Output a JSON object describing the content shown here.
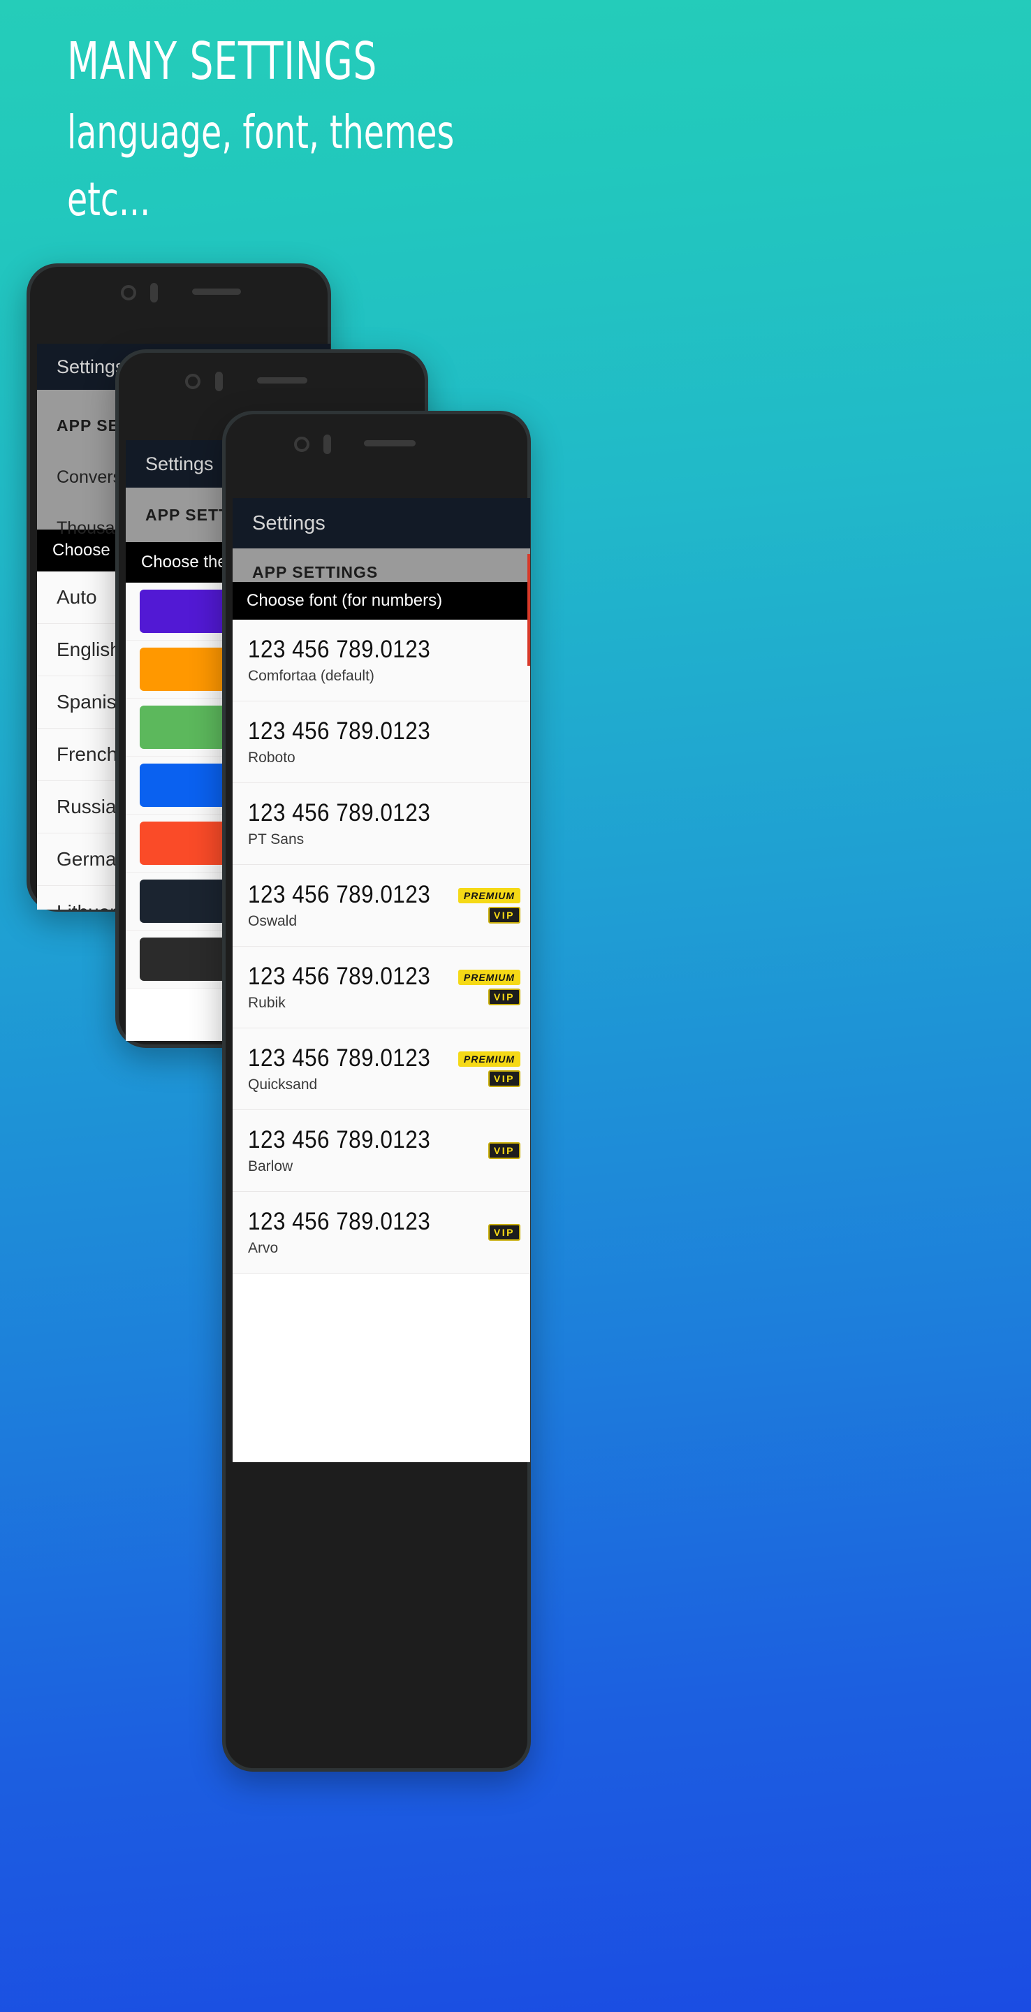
{
  "headline": {
    "line1": "MANY SETTINGS",
    "line2": "language, font, themes",
    "line3": "etc..."
  },
  "background": {
    "top_color": "#25cdb9",
    "bottom_color": "#1b4ce3"
  },
  "phone1": {
    "appbar_title": "Settings",
    "section_header": "APP SETTINGS",
    "setting_rows": [
      "Conversion",
      "Thousand s"
    ],
    "dialog": {
      "title": "Choose app lan",
      "items": [
        "Auto",
        "English",
        "Spanish",
        "French",
        "Russian",
        "German",
        "Lithuanian"
      ]
    }
  },
  "phone2": {
    "appbar_title": "Settings",
    "section_header": "APP SETTINGS",
    "dialog": {
      "title": "Choose theme",
      "swatches": [
        {
          "name": "purple",
          "color": "#5219d4"
        },
        {
          "name": "orange",
          "color": "#ff9800"
        },
        {
          "name": "green",
          "color": "#5cb85c"
        },
        {
          "name": "blue",
          "color": "#0a61f0"
        },
        {
          "name": "red",
          "color": "#fa4b28"
        },
        {
          "name": "navy",
          "color": "#1b2430"
        },
        {
          "name": "dark",
          "color": "#2b2b2b"
        }
      ]
    }
  },
  "phone3": {
    "appbar_title": "Settings",
    "section_header": "APP SETTINGS",
    "dialog": {
      "title": "Choose font (for numbers)",
      "sample": "123 456 789.0123",
      "badge_premium": "PREMIUM",
      "badge_vip": "VIP",
      "fonts": [
        {
          "name": "Comfortaa (default)",
          "premium": false,
          "vip": false
        },
        {
          "name": "Roboto",
          "premium": false,
          "vip": false
        },
        {
          "name": "PT Sans",
          "premium": false,
          "vip": false
        },
        {
          "name": "Oswald",
          "premium": true,
          "vip": true
        },
        {
          "name": "Rubik",
          "premium": true,
          "vip": true
        },
        {
          "name": "Quicksand",
          "premium": true,
          "vip": true
        },
        {
          "name": "Barlow",
          "premium": false,
          "vip": true
        },
        {
          "name": "Arvo",
          "premium": false,
          "vip": true
        }
      ]
    }
  }
}
